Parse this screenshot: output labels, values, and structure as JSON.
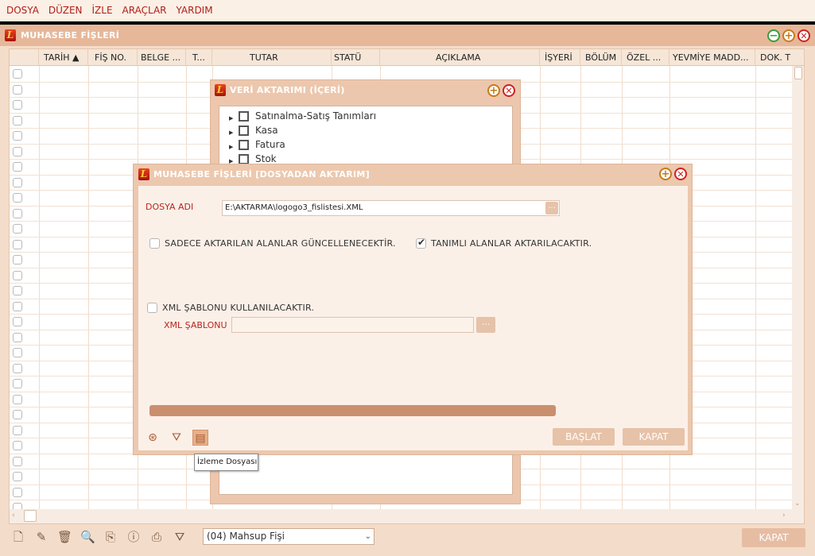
{
  "menu": [
    "DOSYA",
    "DÜZEN",
    "İZLE",
    "ARAÇLAR",
    "YARDIM"
  ],
  "main_window": {
    "title": "MUHASEBE FİŞLERİ"
  },
  "grid": {
    "columns": [
      "TARİH ▲",
      "FİŞ NO.",
      "BELGE ...",
      "T...",
      "TUTAR",
      "STATÜ",
      "AÇIKLAMA",
      "İŞYERİ",
      "BÖLÜM",
      "ÖZEL ...",
      "YEVMİYE MADD...",
      "DOK. T"
    ],
    "row_count": 29
  },
  "veri_window": {
    "title": "VERİ AKTARIMI (İÇERİ)",
    "tree_items": [
      "Satınalma-Satış Tanımları",
      "Kasa",
      "Fatura",
      "Stok"
    ]
  },
  "dialog": {
    "title": "MUHASEBE FİŞLERİ [DOSYADAN AKTARIM]",
    "dosya_label": "DOSYA ADI",
    "dosya_value": "E:\\AKTARMA\\logogo3_fislistesi.XML",
    "dots": "...",
    "chk_sadece": "SADECE AKTARILAN ALANLAR GÜNCELLENECEKTİR.",
    "chk_tanimli": "TANIMLI ALANLAR AKTARILACAKTIR.",
    "chk_xml": "XML ŞABLONU KULLANILACAKTIR.",
    "xml_label": "XML ŞABLONU",
    "xml_value": "",
    "progress": 1.0,
    "baslat": "BAŞLAT",
    "kapat": "KAPAT",
    "tooltip": "İzleme Dosyası"
  },
  "bottom": {
    "combo_value": "(04) Mahsup Fişi",
    "kapat": "KAPAT"
  },
  "colors": {
    "accent": "#b01e18",
    "window_bar": "#e7b799",
    "dialog_bg": "#fbf0e8"
  }
}
